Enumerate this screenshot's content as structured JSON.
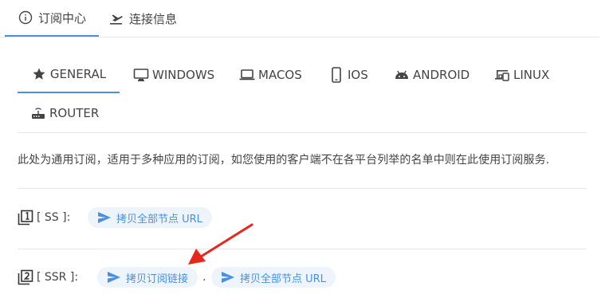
{
  "top_tabs": [
    {
      "label": "订阅中心",
      "icon": "info-circle-icon"
    },
    {
      "label": "连接信息",
      "icon": "flight-takeoff-icon"
    }
  ],
  "platform_tabs": [
    {
      "label": "GENERAL",
      "icon": "star-icon"
    },
    {
      "label": "WINDOWS",
      "icon": "desktop-icon"
    },
    {
      "label": "MACOS",
      "icon": "laptop-icon"
    },
    {
      "label": "IOS",
      "icon": "phone-icon"
    },
    {
      "label": "ANDROID",
      "icon": "android-icon"
    },
    {
      "label": "LINUX",
      "icon": "devices-icon"
    },
    {
      "label": "ROUTER",
      "icon": "router-icon"
    }
  ],
  "description": "此处为通用订阅，适用于多种应用的订阅，如您使用的客户端不在各平台列举的名单中则在此使用订阅服务.",
  "ss": {
    "label": "[ SS ]:",
    "copy_all": "拷贝全部节点 URL"
  },
  "ssr": {
    "label": "[ SSR ]:",
    "copy_sub": "拷贝订阅链接",
    "separator": ".",
    "copy_all": "拷贝全部节点 URL"
  },
  "colors": {
    "accent": "#4a90e2",
    "button_bg": "#eef4fc",
    "annotation_arrow": "#e8261c"
  }
}
